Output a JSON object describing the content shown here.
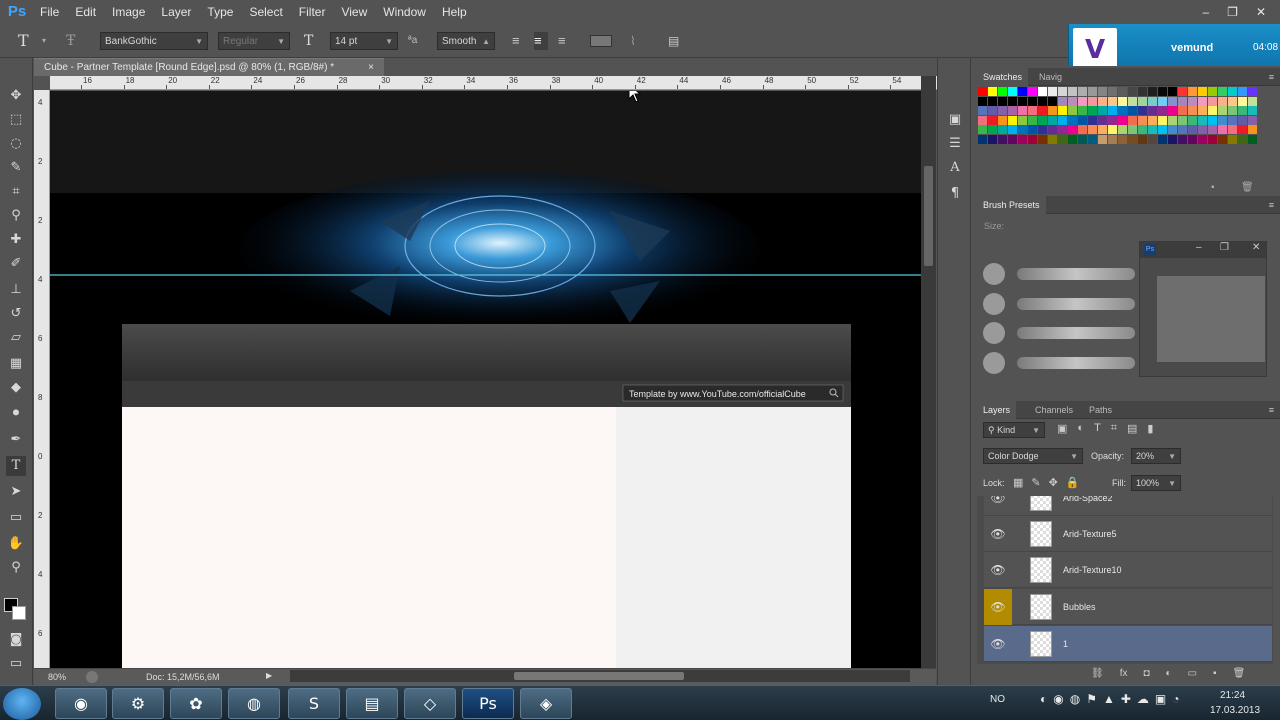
{
  "app": {
    "logo": "Ps",
    "menu": [
      "File",
      "Edit",
      "Image",
      "Layer",
      "Type",
      "Select",
      "Filter",
      "View",
      "Window",
      "Help"
    ],
    "window_controls": [
      "‒",
      "❐",
      "✕"
    ]
  },
  "options_bar": {
    "font_family": "BankGothic",
    "font_style": "Regular",
    "font_size": "14 pt",
    "aa_label": "ªa",
    "antialias": "Smooth"
  },
  "notification": {
    "logo": "V",
    "name": "vemund",
    "time": "04:08"
  },
  "document": {
    "tab_title": "Cube - Partner Template [Round Edge].psd @ 80% (1, RGB/8#) *",
    "close": "×",
    "ruler_top": [
      "16",
      "18",
      "20",
      "22",
      "24",
      "26",
      "28",
      "30",
      "32",
      "34",
      "36",
      "38",
      "40",
      "42",
      "44",
      "46",
      "48",
      "50",
      "52",
      "54"
    ],
    "ruler_left": [
      "4",
      "2",
      "2",
      "4",
      "6",
      "8",
      "0",
      "2",
      "4",
      "6"
    ],
    "banner_text": "Template by www.YouTube.com/officialCube",
    "zoom": "80%",
    "doc_size": "Doc: 15,2M/56,6M"
  },
  "panels": {
    "swatches_tabs": [
      "Swatches",
      "Navig"
    ],
    "brush_presets": {
      "title": "Brush Presets",
      "size_label": "Size:"
    },
    "layers_tabs": [
      "Layers",
      "Channels",
      "Paths"
    ],
    "kind_filter": "Kind",
    "blend_mode": "Color Dodge",
    "opacity_label": "Opacity:",
    "opacity_value": "20%",
    "lock_label": "Lock:",
    "fill_label": "Fill:",
    "fill_value": "100%",
    "layers": [
      {
        "name": "Arid-Space2",
        "highlight": false,
        "eye_gold": false
      },
      {
        "name": "Arid-Texture5",
        "highlight": false,
        "eye_gold": false
      },
      {
        "name": "Arid-Texture10",
        "highlight": false,
        "eye_gold": false
      },
      {
        "name": "Bubbles",
        "highlight": false,
        "eye_gold": true
      },
      {
        "name": "1",
        "highlight": true,
        "eye_gold": false
      }
    ]
  },
  "taskbar": {
    "lang": "NO",
    "time": "21:24",
    "date": "17.03.2013",
    "apps": [
      "chrome",
      "steam",
      "paint",
      "spotify",
      "skype",
      "explorer",
      "app7",
      "photoshop",
      "app9"
    ]
  },
  "colors": {
    "accent_blue": "#1b8fc9",
    "gold_eye": "#b38b00",
    "selected_layer": "#5a6a8a"
  }
}
